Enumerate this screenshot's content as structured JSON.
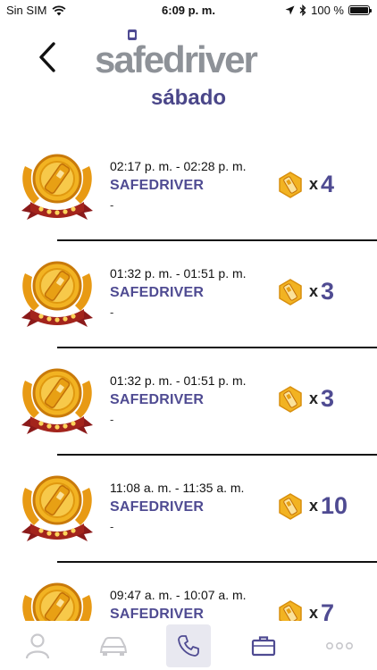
{
  "status_bar": {
    "carrier": "Sin SIM",
    "time": "6:09 p. m.",
    "battery": "100 %"
  },
  "header": {
    "logo_text": "safedriver",
    "day_title": "sábado"
  },
  "trips": [
    {
      "time_range": "02:17 p. m. - 02:28 p. m.",
      "label": "SAFEDRIVER",
      "detail": "-",
      "multiplier": "x",
      "count": "4"
    },
    {
      "time_range": "01:32 p. m. - 01:51 p. m.",
      "label": "SAFEDRIVER",
      "detail": "-",
      "multiplier": "x",
      "count": "3"
    },
    {
      "time_range": "01:32 p. m. - 01:51 p. m.",
      "label": "SAFEDRIVER",
      "detail": "-",
      "multiplier": "x",
      "count": "3"
    },
    {
      "time_range": "11:08 a. m. - 11:35 a. m.",
      "label": "SAFEDRIVER",
      "detail": "-",
      "multiplier": "x",
      "count": "10"
    },
    {
      "time_range": "09:47 a. m. - 10:07 a. m.",
      "label": "SAFEDRIVER",
      "detail": "-",
      "multiplier": "x",
      "count": "7"
    }
  ],
  "tabbar": {
    "items": [
      {
        "icon": "person-icon"
      },
      {
        "icon": "car-icon"
      },
      {
        "icon": "phone-icon"
      },
      {
        "icon": "briefcase-icon"
      },
      {
        "icon": "more-icon"
      }
    ],
    "active_index": 2
  },
  "colors": {
    "accent": "#4f4b92",
    "logo_gray": "#8e9298",
    "medal_gold": "#f0a81c",
    "ribbon_red": "#8b1a1a"
  }
}
